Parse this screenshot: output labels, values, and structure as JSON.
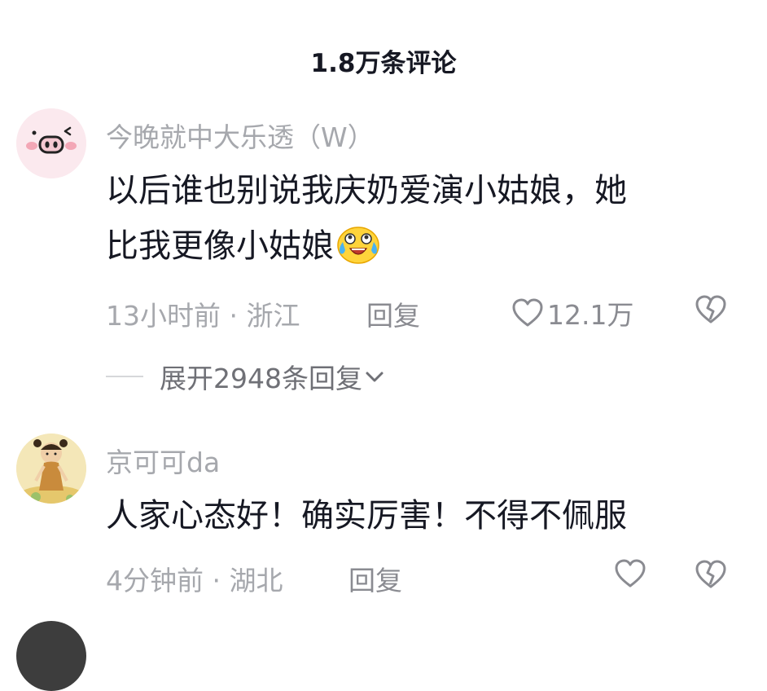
{
  "header": {
    "title": "1.8万条评论"
  },
  "comments": [
    {
      "username": "今晚就中大乐透（W）",
      "text_line1": "以后谁也别说我庆奶爱演小姑娘，她",
      "text_line2": "比我更像小姑娘",
      "time_location": "13小时前 · 浙江",
      "reply_label": "回复",
      "like_count": "12.1万",
      "expand_label": "展开2948条回复",
      "avatar_icon": "pig-face-icon",
      "emoji_icon": "crying-laughing-emoji-icon"
    },
    {
      "username": "京可可da",
      "text": "人家心态好！确实厉害！不得不佩服",
      "time_location": "4分钟前 · 湖北",
      "reply_label": "回复",
      "avatar_icon": "cartoon-girl-avatar-icon"
    }
  ],
  "colors": {
    "muted": "#a6a8ad",
    "text": "#161823",
    "pig_pink": "#f7dde3"
  }
}
